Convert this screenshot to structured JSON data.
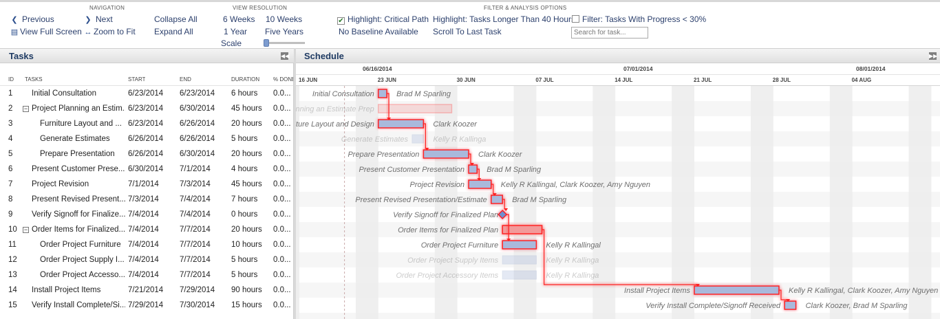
{
  "toolbar": {
    "navigation": {
      "heading": "NAVIGATION",
      "previous": "Previous",
      "next": "Next",
      "view_full_screen": "View Full Screen",
      "zoom_to_fit": "Zoom to Fit",
      "collapse_all": "Collapse All",
      "expand_all": "Expand All"
    },
    "view_resolution": {
      "heading": "VIEW RESOLUTION",
      "six_weeks": "6 Weeks",
      "ten_weeks": "10 Weeks",
      "one_year": "1 Year",
      "five_years": "Five Years",
      "scale_label": "Scale",
      "scale_value": 0
    },
    "filter_analysis": {
      "heading": "FILTER & ANALYSIS OPTIONS",
      "highlight_critical_path": "Highlight: Critical Path",
      "highlight_critical_path_checked": true,
      "no_baseline": "No Baseline Available",
      "highlight_long_tasks": "Highlight: Tasks Longer Than 40 Hours",
      "scroll_to_last_task": "Scroll To Last Task",
      "filter_progress": "Filter: Tasks With Progress < 30%",
      "filter_progress_checked": false,
      "search_placeholder": "Search for task..."
    }
  },
  "tasks_panel": {
    "title": "Tasks",
    "columns": {
      "id": "ID",
      "tasks": "TASKS",
      "start": "START",
      "end": "END",
      "duration": "DURATION",
      "done": "% DONE"
    },
    "rows": [
      {
        "id": "1",
        "name": "Initial Consultation",
        "start": "6/23/2014",
        "end": "6/23/2014",
        "duration": "6 hours",
        "done": "0.0...",
        "level": 0,
        "parent": false
      },
      {
        "id": "2",
        "name": "Project Planning an Estim...",
        "start": "6/23/2014",
        "end": "6/30/2014",
        "duration": "45 hours",
        "done": "0.0...",
        "level": 0,
        "parent": true
      },
      {
        "id": "3",
        "name": "Furniture Layout and ...",
        "start": "6/23/2014",
        "end": "6/26/2014",
        "duration": "20 hours",
        "done": "0.0...",
        "level": 1,
        "parent": false
      },
      {
        "id": "4",
        "name": "Generate Estimates",
        "start": "6/26/2014",
        "end": "6/26/2014",
        "duration": "5 hours",
        "done": "0.0...",
        "level": 1,
        "parent": false
      },
      {
        "id": "5",
        "name": "Prepare Presentation",
        "start": "6/26/2014",
        "end": "6/30/2014",
        "duration": "20 hours",
        "done": "0.0...",
        "level": 1,
        "parent": false
      },
      {
        "id": "6",
        "name": "Present Customer Prese...",
        "start": "6/30/2014",
        "end": "7/1/2014",
        "duration": "4 hours",
        "done": "0.0...",
        "level": 0,
        "parent": false
      },
      {
        "id": "7",
        "name": "Project Revision",
        "start": "7/1/2014",
        "end": "7/3/2014",
        "duration": "45 hours",
        "done": "0.0...",
        "level": 0,
        "parent": false
      },
      {
        "id": "8",
        "name": "Present Revised Present...",
        "start": "7/3/2014",
        "end": "7/4/2014",
        "duration": "7 hours",
        "done": "0.0...",
        "level": 0,
        "parent": false
      },
      {
        "id": "9",
        "name": "Verify Signoff for Finalize...",
        "start": "7/4/2014",
        "end": "7/4/2014",
        "duration": "0 hours",
        "done": "0.0...",
        "level": 0,
        "parent": false
      },
      {
        "id": "10",
        "name": "Order Items for Finalized...",
        "start": "7/4/2014",
        "end": "7/7/2014",
        "duration": "20 hours",
        "done": "0.0...",
        "level": 0,
        "parent": true
      },
      {
        "id": "11",
        "name": "Order Project Furniture",
        "start": "7/4/2014",
        "end": "7/7/2014",
        "duration": "10 hours",
        "done": "0.0...",
        "level": 1,
        "parent": false
      },
      {
        "id": "12",
        "name": "Order Project Supply I...",
        "start": "7/4/2014",
        "end": "7/7/2014",
        "duration": "5 hours",
        "done": "0.0...",
        "level": 1,
        "parent": false
      },
      {
        "id": "13",
        "name": "Order Project Accesso...",
        "start": "7/4/2014",
        "end": "7/7/2014",
        "duration": "5 hours",
        "done": "0.0...",
        "level": 1,
        "parent": false
      },
      {
        "id": "14",
        "name": "Install Project Items",
        "start": "7/21/2014",
        "end": "7/29/2014",
        "duration": "90 hours",
        "done": "0.0...",
        "level": 0,
        "parent": false
      },
      {
        "id": "15",
        "name": "Verify Install Complete/Si...",
        "start": "7/29/2014",
        "end": "7/30/2014",
        "duration": "15 hours",
        "done": "0.0...",
        "level": 0,
        "parent": false
      }
    ]
  },
  "schedule_panel": {
    "title": "Schedule",
    "months": [
      "06/16/2014",
      "07/01/2014",
      "08/01/2014"
    ],
    "weeks": [
      "16 JUN",
      "23 JUN",
      "30 JUN",
      "07 JUL",
      "14 JUL",
      "21 JUL",
      "28 JUL",
      "04 AUG"
    ],
    "today": "6/20/2014",
    "bars": [
      {
        "task": "Initial Consultation",
        "start": "6/23/2014",
        "days": 0.75,
        "kind": "task",
        "critical": true,
        "dim": false,
        "resources": "Brad M Sparling"
      },
      {
        "task": "Project Planning an Estimate Prep",
        "start": "6/23/2014",
        "days": 6.5,
        "kind": "summary",
        "critical": true,
        "dim": true,
        "resources": ""
      },
      {
        "task": "Furniture Layout and Design",
        "start": "6/23/2014",
        "days": 4,
        "kind": "task",
        "critical": true,
        "dim": false,
        "resources": "Clark Koozer"
      },
      {
        "task": "Generate Estimates",
        "start": "6/26/2014",
        "days": 1,
        "kind": "task",
        "critical": false,
        "dim": true,
        "resources": "Kelly R Kallinga"
      },
      {
        "task": "Prepare Presentation",
        "start": "6/27/2014",
        "days": 4,
        "kind": "task",
        "critical": true,
        "dim": false,
        "resources": "Clark Koozer"
      },
      {
        "task": "Present Customer Presentation",
        "start": "7/1/2014",
        "days": 0.75,
        "kind": "task",
        "critical": true,
        "dim": false,
        "resources": "Brad M Sparling"
      },
      {
        "task": "Project Revision",
        "start": "7/1/2014",
        "days": 2,
        "kind": "task",
        "critical": true,
        "dim": false,
        "resources": "Kelly R Kallingal, Clark Koozer, Amy Nguyen"
      },
      {
        "task": "Present Revised Presentation/Estimate",
        "start": "7/3/2014",
        "days": 1,
        "kind": "task",
        "critical": true,
        "dim": false,
        "resources": "Brad M Sparling"
      },
      {
        "task": "Verify Signoff for Finalized Plan",
        "start": "7/4/2014",
        "days": 0,
        "kind": "milestone",
        "critical": true,
        "dim": false,
        "resources": ""
      },
      {
        "task": "Order Items for Finalized Plan",
        "start": "7/4/2014",
        "days": 3.5,
        "kind": "summary",
        "critical": true,
        "dim": false,
        "resources": ""
      },
      {
        "task": "Order Project Furniture",
        "start": "7/4/2014",
        "days": 3,
        "kind": "task",
        "critical": true,
        "dim": false,
        "resources": "Kelly R Kallingal"
      },
      {
        "task": "Order Project Supply Items",
        "start": "7/4/2014",
        "days": 3,
        "kind": "task",
        "critical": false,
        "dim": true,
        "resources": "Kelly R Kallinga"
      },
      {
        "task": "Order Project Accessory Items",
        "start": "7/4/2014",
        "days": 3,
        "kind": "task",
        "critical": false,
        "dim": true,
        "resources": "Kelly R Kallinga"
      },
      {
        "task": "Install Project Items",
        "start": "7/21/2014",
        "days": 7.5,
        "kind": "task",
        "critical": true,
        "dim": false,
        "resources": "Kelly R Kallingal, Clark Koozer, Amy Nguyen"
      },
      {
        "task": "Verify Install Complete/Signoff Received",
        "start": "7/29/2014",
        "days": 1,
        "kind": "task",
        "critical": true,
        "dim": false,
        "resources": "Clark Koozer, Brad M Sparling"
      }
    ]
  },
  "colors": {
    "accent": "#2b3f6c",
    "bar_fill": "#a9b9dc",
    "critical_glow": "#ff2020",
    "summary_fill": "#f29a9a",
    "weekend": "#ececec",
    "stripe": "#f6f6f6"
  },
  "icons": {
    "previous": "chevron-left-icon",
    "next": "chevron-right-icon",
    "full_screen": "full-screen-icon",
    "zoom_to_fit": "zoom-to-fit-icon"
  }
}
